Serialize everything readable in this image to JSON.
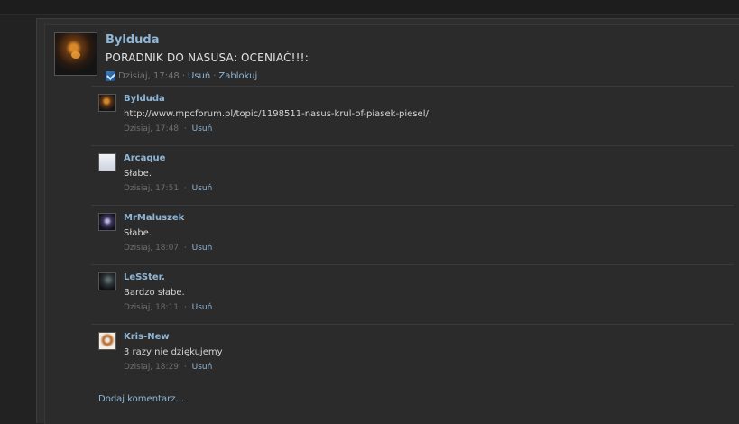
{
  "post": {
    "author": "Bylduda",
    "status": "PORADNIK DO NASUSA: OCENIAĆ!!!:",
    "time": "Dzisiaj, 17:48",
    "delete_label": "Usuń",
    "block_label": "Zablokuj",
    "separator": "·"
  },
  "comments": [
    {
      "author": "Bylduda",
      "text": "http://www.mpcforum.pl/topic/1198511-nasus-krul-of-piasek-piesel/",
      "time": "Dzisiaj, 17:48",
      "delete_label": "Usuń",
      "avatar": "warrior-avatar"
    },
    {
      "author": "Arcaque",
      "text": "Słabe.",
      "time": "Dzisiaj, 17:51",
      "delete_label": "Usuń",
      "avatar": "default-avatar"
    },
    {
      "author": "MrMaluszek",
      "text": "Słabe.",
      "time": "Dzisiaj, 18:07",
      "delete_label": "Usuń",
      "avatar": "dark-figure-avatar"
    },
    {
      "author": "LeSSter.",
      "text": "Bardzo słabe.",
      "time": "Dzisiaj, 18:11",
      "delete_label": "Usuń",
      "avatar": "shadow-avatar"
    },
    {
      "author": "Kris-New",
      "text": "3 razy nie dziękujemy",
      "time": "Dzisiaj, 18:29",
      "delete_label": "Usuń",
      "avatar": "portrait-avatar"
    }
  ],
  "add_comment_label": "Dodaj komentarz...",
  "colors": {
    "link": "#8fb6d6",
    "background": "#2b2b2b",
    "meta": "#767676"
  }
}
